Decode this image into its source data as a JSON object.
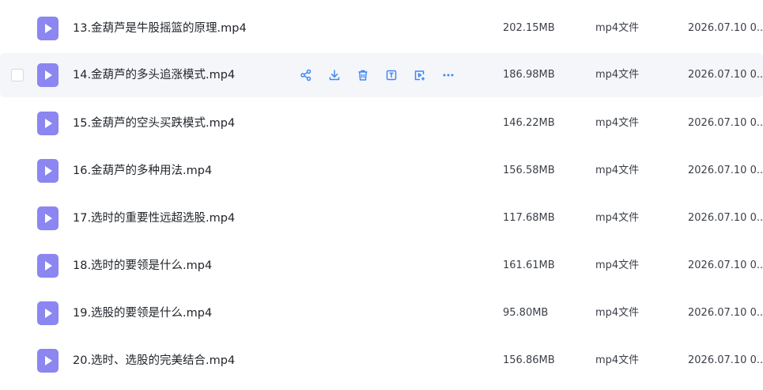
{
  "files": [
    {
      "name": "13.金葫芦是牛股摇篮的原理.mp4",
      "size": "202.15MB",
      "type": "mp4文件",
      "date": "2026.07.10 0..."
    },
    {
      "name": "14.金葫芦的多头追涨模式.mp4",
      "size": "186.98MB",
      "type": "mp4文件",
      "date": "2026.07.10 0...",
      "hovered": true
    },
    {
      "name": "15.金葫芦的空头买跌模式.mp4",
      "size": "146.22MB",
      "type": "mp4文件",
      "date": "2026.07.10 0..."
    },
    {
      "name": "16.金葫芦的多种用法.mp4",
      "size": "156.58MB",
      "type": "mp4文件",
      "date": "2026.07.10 0..."
    },
    {
      "name": "17.选时的重要性远超选股.mp4",
      "size": "117.68MB",
      "type": "mp4文件",
      "date": "2026.07.10 0..."
    },
    {
      "name": "18.选时的要领是什么.mp4",
      "size": "161.61MB",
      "type": "mp4文件",
      "date": "2026.07.10 0..."
    },
    {
      "name": "19.选股的要领是什么.mp4",
      "size": "95.80MB",
      "type": "mp4文件",
      "date": "2026.07.10 0..."
    },
    {
      "name": "20.选时、选股的完美结合.mp4",
      "size": "156.86MB",
      "type": "mp4文件",
      "date": "2026.07.10 0..."
    }
  ],
  "row_actions": [
    {
      "icon": "share-icon"
    },
    {
      "icon": "download-icon"
    },
    {
      "icon": "delete-icon"
    },
    {
      "icon": "rename-icon"
    },
    {
      "icon": "move-icon"
    },
    {
      "icon": "more-icon"
    }
  ],
  "colors": {
    "accent": "#3f88f5",
    "icon_purple": "#8b86f0",
    "hover_bg": "#f5f6fa"
  }
}
